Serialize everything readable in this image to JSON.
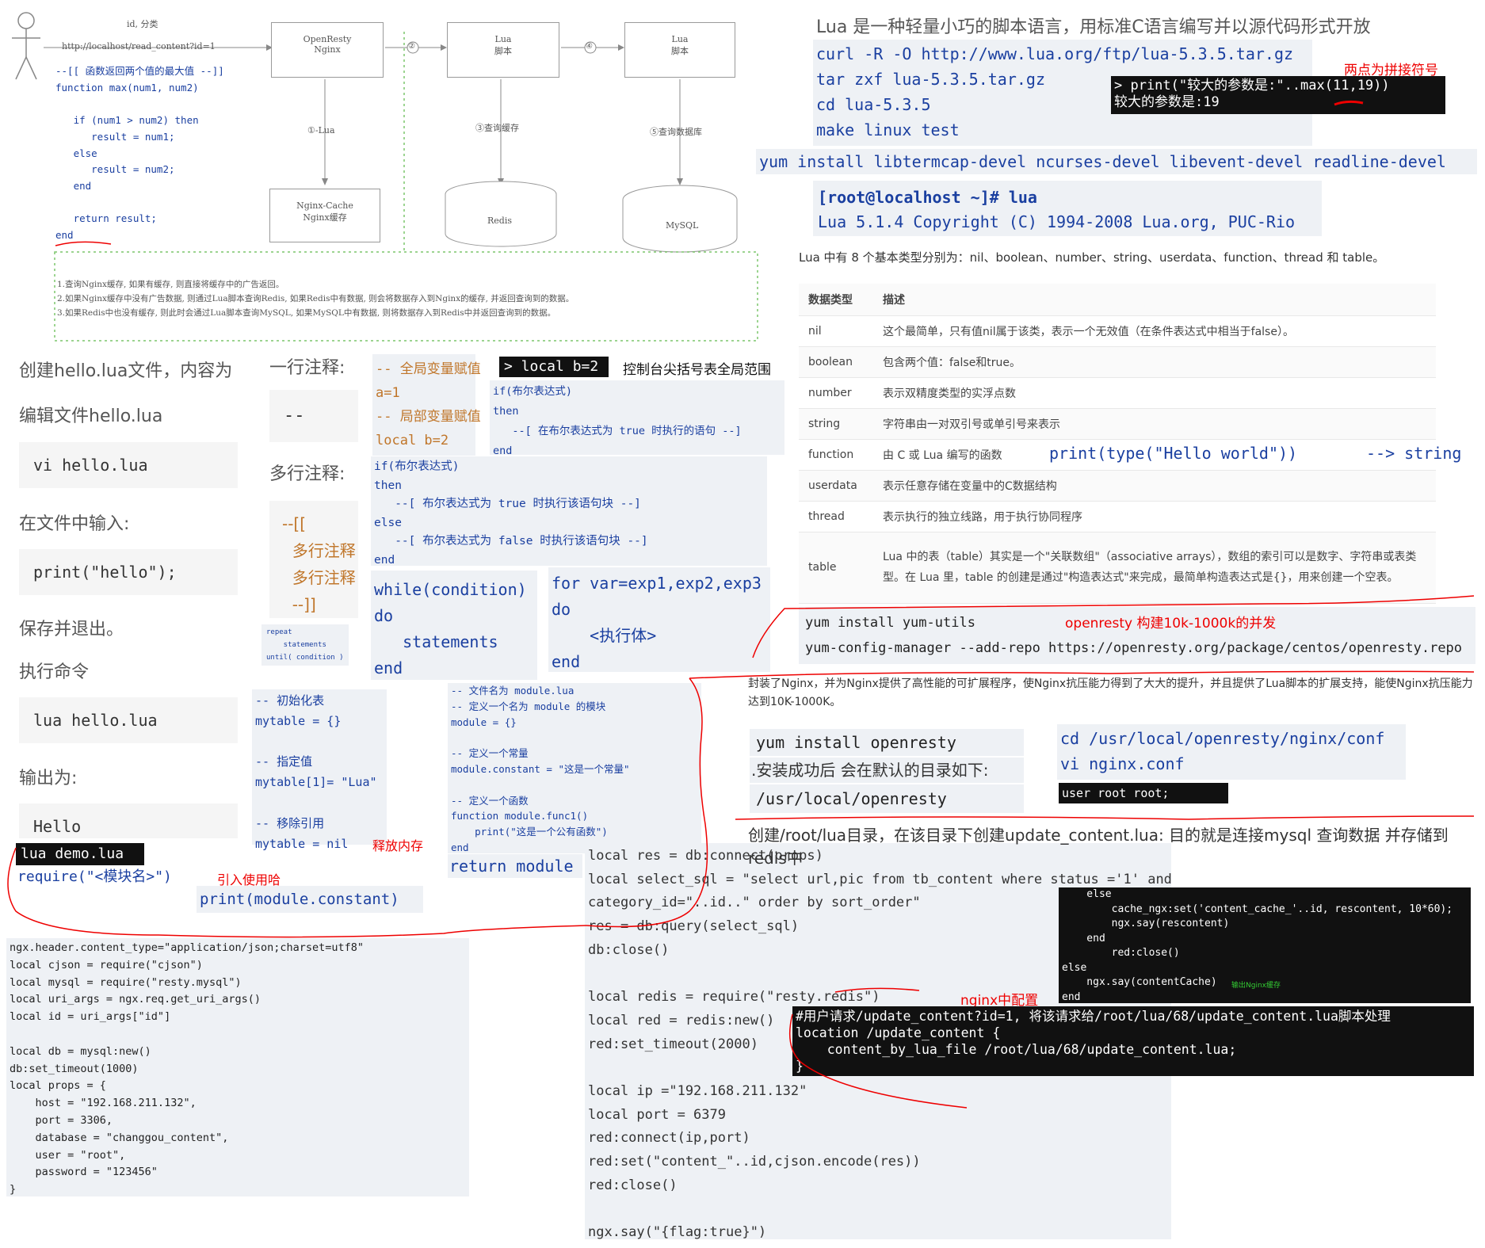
{
  "flow": {
    "actor_label": "id, 分类",
    "url_label": "http://localhost/read_content?id=1",
    "boxes": [
      "OpenResty\nNginx",
      "Lua\n脚本",
      "Lua\n脚本",
      "Nginx-Cache\nNginx缓存",
      "Redis",
      "MySQL"
    ],
    "steps": [
      "②",
      "④",
      "①-Lua",
      "③查询缓存",
      "⑤查询数据库"
    ],
    "notes": "1.查询Nginx缓存, 如果有缓存, 则直接将缓存中的广告返回。\n2.如果Nginx缓存中没有广告数据, 则通过Lua脚本查询Redis, 如果Redis中有数据, 则会将数据存入到Nginx的缓存, 并返回查询到的数据。\n3.如果Redis中也没有缓存, 则此时会通过Lua脚本查询MySQL, 如果MySQL中有数据, 则将数据存入到Redis中并返回查询到的数据。"
  },
  "max_code": "--[[ 函数返回两个值的最大值 --]]\nfunction max(num1, num2)\n\n   if (num1 > num2) then\n      result = num1;\n   else\n      result = num2;\n   end\n\n   return result;\nend",
  "left": {
    "create_file": "创建hello.lua文件，内容为",
    "edit_file": "编辑文件hello.lua",
    "vi_cmd": "vi hello.lua",
    "input_in_file": "在文件中输入:",
    "print_hello": "print(\"hello\");",
    "save_exit": "保存并退出。",
    "exec_cmd": "执行命令",
    "lua_hello": "lua hello.lua",
    "output_is": "输出为:",
    "hello_out": "Hello"
  },
  "comments": {
    "single_label": "一行注释:",
    "single_syntax": "--",
    "multi_label": "多行注释:",
    "multi_code": "--[[\n  多行注释\n  多行注释\n  --]]",
    "repeat_code": "repeat\n    statements\nuntil( condition )"
  },
  "vars": {
    "code": "-- 全局变量赋值\na=1\n-- 局部变量赋值\nlocal b=2",
    "console_cmd": "> local b=2",
    "console_note": "控制台尖括号表全局范围"
  },
  "if_code1": "if(布尔表达式)\nthen\n   --[ 在布尔表达式为 true 时执行的语句 --]\nend",
  "if_code2": "if(布尔表达式)\nthen\n   --[ 布尔表达式为 true 时执行该语句块 --]\nelse\n   --[ 布尔表达式为 false 时执行该语句块 --]\nend",
  "while_code": "while(condition)\ndo\n   statements\nend",
  "for_code": "for var=exp1,exp2,exp3\ndo\n    <执行体>\nend",
  "table_code": "-- 初始化表\nmytable = {}\n\n-- 指定值\nmytable[1]= \"Lua\"\n\n-- 移除引用\nmytable = nil",
  "free_mem": "释放内存",
  "module_code": "-- 文件名为 module.lua\n-- 定义一个名为 module 的模块\nmodule = {}\n\n-- 定义一个常量\nmodule.constant = \"这是一个常量\"\n\n-- 定义一个函数\nfunction module.func1()\n    print(\"这是一个公有函数\")\nend",
  "return_module": "return module",
  "demo": {
    "file": "lua demo.lua",
    "require": "require(\"<模块名>\")",
    "note": "引入使用哈",
    "print": "print(module.constant)"
  },
  "nginx_lua_code": "ngx.header.content_type=\"application/json;charset=utf8\"\nlocal cjson = require(\"cjson\")\nlocal mysql = require(\"resty.mysql\")\nlocal uri_args = ngx.req.get_uri_args()\nlocal id = uri_args[\"id\"]\n\nlocal db = mysql:new()\ndb:set_timeout(1000)\nlocal props = {\n    host = \"192.168.211.132\",\n    port = 3306,\n    database = \"changgou_content\",\n    user = \"root\",\n    password = \"123456\"\n}",
  "update_code": "local res = db:connect(props)\nlocal select_sql = \"select url,pic from tb_content where status ='1' and\ncategory_id=\"..id..\" order by sort_order\"\nres = db:query(select_sql)\ndb:close()\n\nlocal redis = require(\"resty.redis\")\nlocal red = redis:new()\nred:set_timeout(2000)\n\nlocal ip =\"192.168.211.132\"\nlocal port = 6379\nred:connect(ip,port)\nred:set(\"content_\"..id,cjson.encode(res))\nred:close()\n\nngx.say(\"{flag:true}\")",
  "cache_code": "    else\n        cache_ngx:set('content_cache_'..id, rescontent, 10*60);\n        ngx.say(rescontent)\n    end\n        red:close()\nelse\n    ngx.say(contentCache)\nend",
  "cache_note": "输出Nginx缓存",
  "nginx_conf_label": "nginx中配置",
  "nginx_conf_code": "#用户请求/update_content?id=1, 将该请求给/root/lua/68/update_content.lua脚本处理\nlocation /update_content {\n    content_by_lua_file /root/lua/68/update_content.lua;\n}",
  "right": {
    "intro": "Lua 是一种轻量小巧的脚本语言，用标准C语言编写并以源代码形式开放",
    "install_cmds": [
      "curl -R -O http://www.lua.org/ftp/lua-5.3.5.tar.gz",
      "tar zxf lua-5.3.5.tar.gz",
      "cd lua-5.3.5",
      "make linux test"
    ],
    "concat_note": "两点为拼接符号",
    "concat_code": "> print(\"较大的参数是:\"..max(11,19))\n较大的参数是:19",
    "yum_deps": "yum install libtermcap-devel ncurses-devel libevent-devel readline-devel",
    "prompt": "[root@localhost ~]# lua",
    "lua_version": "Lua 5.1.4  Copyright (C) 1994-2008 Lua.org, PUC-Rio",
    "types_intro": "Lua 中有 8 个基本类型分别为：nil、boolean、number、string、userdata、function、thread 和 table。",
    "table_headers": [
      "数据类型",
      "描述"
    ],
    "types": [
      {
        "name": "nil",
        "desc": "这个最简单，只有值nil属于该类，表示一个无效值（在条件表达式中相当于false）。"
      },
      {
        "name": "boolean",
        "desc": "包含两个值：false和true。"
      },
      {
        "name": "number",
        "desc": "表示双精度类型的实浮点数"
      },
      {
        "name": "string",
        "desc": "字符串由一对双引号或单引号来表示"
      },
      {
        "name": "function",
        "desc": "由 C 或 Lua 编写的函数"
      },
      {
        "name": "userdata",
        "desc": "表示任意存储在变量中的C数据结构"
      },
      {
        "name": "thread",
        "desc": "表示执行的独立线路，用于执行协同程序"
      },
      {
        "name": "table",
        "desc": "Lua 中的表（table）其实是一个\"关联数组\"（associative arrays），数组的索引可以是数字、字符串或表类型。在 Lua 里，table 的创建是通过\"构造表达式\"来完成，最简单构造表达式是{}，用来创建一个空表。"
      }
    ],
    "type_example": "print(type(\"Hello world\"))",
    "type_result": "--> string",
    "yum_utils": "yum install yum-utils",
    "openresty_note": "openresty 构建10k-1000k的并发",
    "add_repo": "yum-config-manager --add-repo https://openresty.org/package/centos/openresty.repo",
    "openresty_desc": "封装了Nginx，并为Nginx提供了高性能的可扩展程序，使Nginx抗压能力得到了大大的提升，并且提供了Lua脚本的扩展支持，能使Nginx抗压能力达到10K-1000K。",
    "yum_openresty": "yum install openresty",
    "install_dir_note": ".安装成功后 会在默认的目录如下:",
    "install_dir": "/usr/local/openresty",
    "cd_conf": "cd /usr/local/openresty/nginx/conf",
    "vi_conf": "vi nginx.conf",
    "user_root": "user  root root;",
    "update_desc": "创建/root/lua目录，在该目录下创建update_content.lua:  目的就是连接mysql 查询数据 并存储到redis中"
  }
}
